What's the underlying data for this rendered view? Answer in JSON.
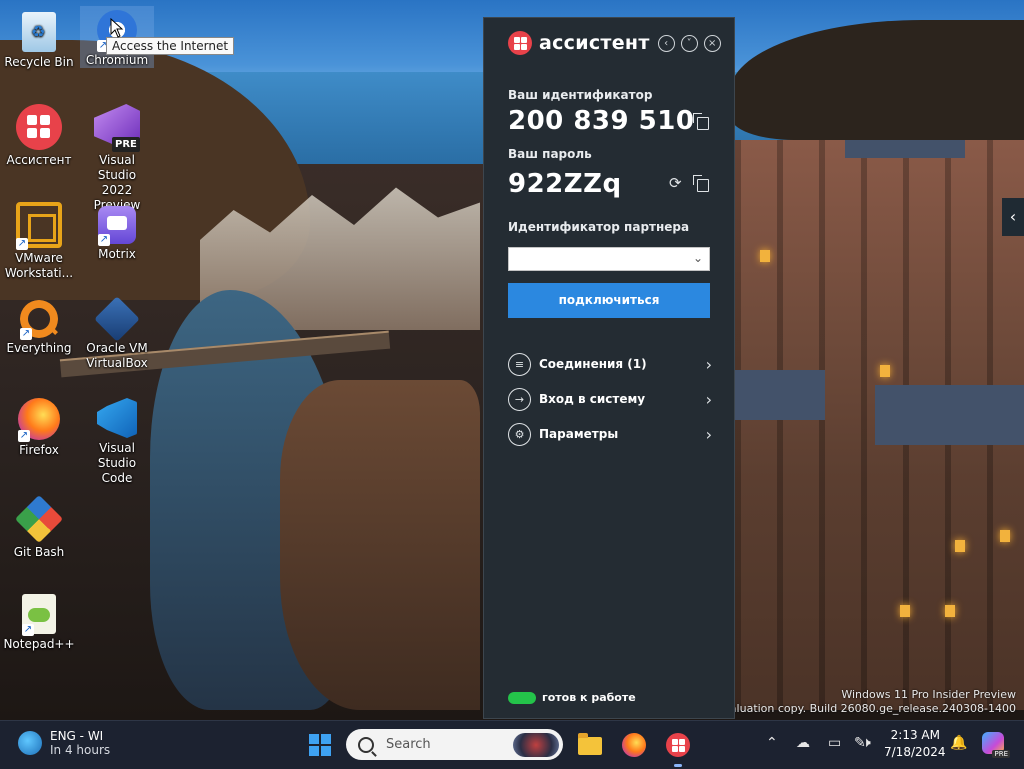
{
  "desktop": {
    "tooltip": "Access the Internet",
    "icons": [
      {
        "label": "Recycle Bin",
        "icon": "recycle-bin-icon"
      },
      {
        "label": "Chromium",
        "icon": "chromium-icon"
      },
      {
        "label": "Ассистент",
        "icon": "assistant-icon"
      },
      {
        "label": "Visual Studio\n2022 Preview",
        "line1": "Visual Studio",
        "line2": "2022 Preview",
        "badge": "PRE",
        "icon": "visual-studio-preview-icon"
      },
      {
        "label": "VMware Workstati...",
        "line1": "VMware",
        "line2": "Workstati...",
        "icon": "vmware-icon"
      },
      {
        "label": "Motrix",
        "icon": "motrix-icon"
      },
      {
        "label": "Everything",
        "icon": "everything-icon"
      },
      {
        "label": "Oracle VM VirtualBox",
        "line1": "Oracle VM",
        "line2": "VirtualBox",
        "icon": "virtualbox-icon"
      },
      {
        "label": "Firefox",
        "icon": "firefox-icon"
      },
      {
        "label": "Visual Studio Code",
        "line1": "Visual Studio",
        "line2": "Code",
        "icon": "vscode-icon"
      },
      {
        "label": "Git Bash",
        "icon": "git-bash-icon"
      },
      {
        "label": "Notepad++",
        "icon": "notepadpp-icon"
      }
    ],
    "watermark": {
      "line1": "Windows 11 Pro Insider Preview",
      "line2": "Evaluation copy. Build 26080.ge_release.240308-1400"
    }
  },
  "assistant": {
    "brand": "ассистент",
    "your_id_label": "Ваш идентификатор",
    "your_id": "200 839 510",
    "your_password_label": "Ваш пароль",
    "your_password": "922ZZq",
    "partner_id_label": "Идентификатор партнера",
    "partner_id_value": "",
    "connect_button": "подключиться",
    "menu": [
      {
        "label": "Соединения (1)",
        "icon": "list-icon"
      },
      {
        "label": "Вход в систему",
        "icon": "login-icon"
      },
      {
        "label": "Параметры",
        "icon": "settings-icon"
      }
    ],
    "status": "готов к работе",
    "status_color": "#24c34a",
    "accent": "#2b88e0",
    "brand_color": "#e8424a"
  },
  "taskbar": {
    "weather": {
      "line1": "ENG - WI",
      "line2": "In 4 hours"
    },
    "search_placeholder": "Search",
    "apps": [
      "file-explorer-icon",
      "firefox-icon",
      "assistant-icon"
    ],
    "clock": {
      "time": "2:13 AM",
      "date": "7/18/2024"
    },
    "tray_icons": [
      "chevron-up-icon",
      "cloud-off-icon",
      "display-icon",
      "volume-muted-icon",
      "pen-icon",
      "notification-icon",
      "copilot-icon"
    ]
  }
}
